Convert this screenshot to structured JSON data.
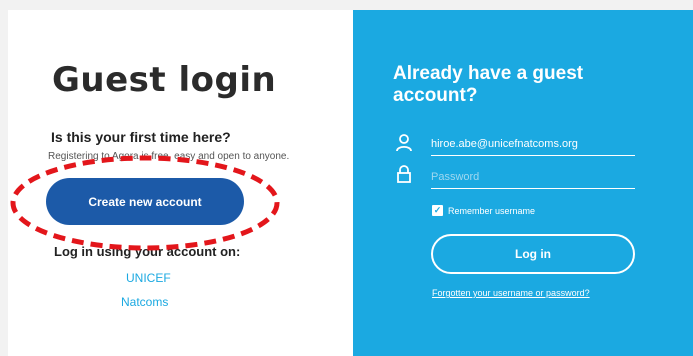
{
  "left": {
    "title": "Guest login",
    "first_time_question": "Is this your first time here?",
    "free_text": "Registering to Agora is free, easy and open to anyone.",
    "create_button": "Create new account",
    "login_using": "Log in using your account on:",
    "links": [
      "UNICEF",
      "Natcoms"
    ]
  },
  "right": {
    "title": "Already have a guest account?",
    "username_value": "hiroe.abe@unicefnatcoms.org",
    "password_placeholder": "Password",
    "remember_label": "Remember username",
    "remember_checked": true,
    "login_button": "Log in",
    "forgot_link": "Forgotten your username or password?"
  },
  "icons": {
    "user": "user-icon",
    "lock": "lock-icon",
    "check": "checkmark-icon"
  },
  "colors": {
    "brand_blue": "#1ba9e1",
    "button_blue": "#1c5aa8",
    "annotation_red": "#e3161b"
  }
}
